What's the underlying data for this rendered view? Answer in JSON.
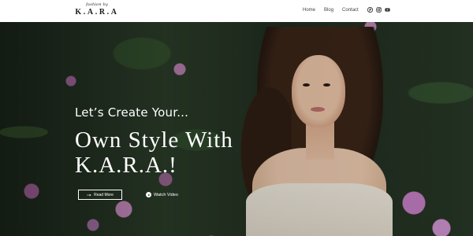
{
  "logo": {
    "script": "fashion by",
    "main": "K.A.R.A"
  },
  "nav": [
    {
      "label": "Home"
    },
    {
      "label": "Blog"
    },
    {
      "label": "Contact"
    }
  ],
  "social": [
    "pinterest-icon",
    "instagram-icon",
    "youtube-icon"
  ],
  "hero": {
    "subtitle": "Let’s Create Your...",
    "title_line1": "Own Style With",
    "title_line2": "K.A.R.A.!",
    "read_more": "Read More",
    "watch_video": "Watch Video"
  },
  "colors": {
    "header_bg": "#ffffff",
    "hero_text": "#ffffff",
    "foliage": "#2c3e2a",
    "flowers": "#c98ac6"
  }
}
